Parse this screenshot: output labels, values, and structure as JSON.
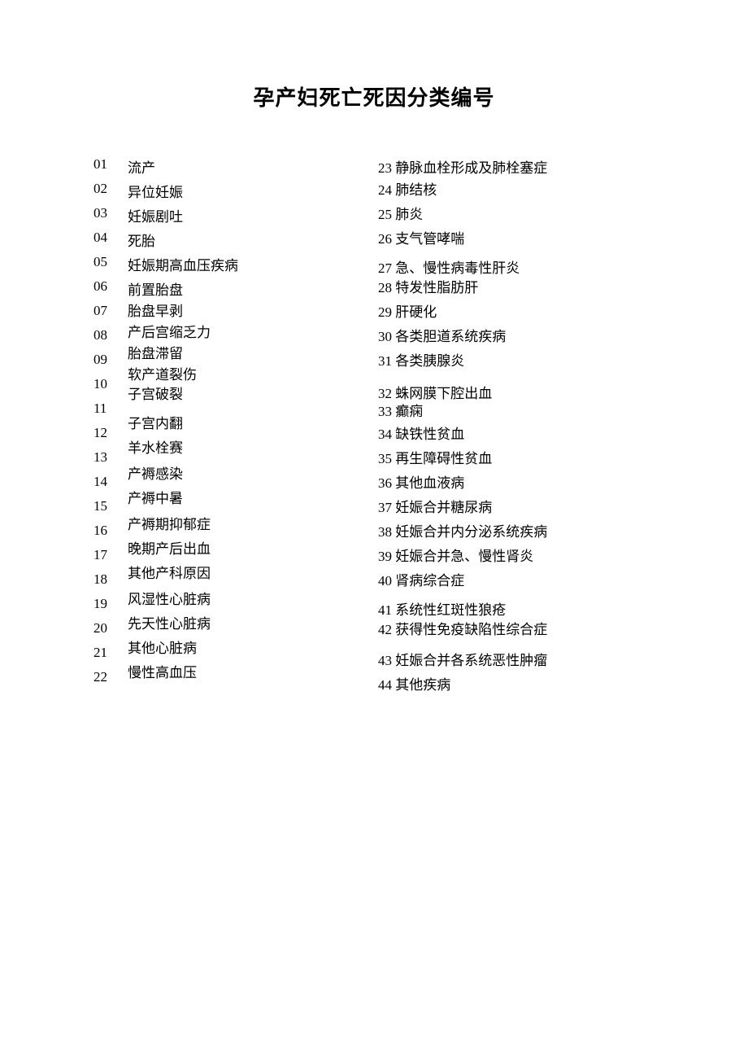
{
  "title": "孕产妇死亡死因分类编号",
  "left_numbers": [
    "01",
    "02",
    "03",
    "04",
    "05",
    "06",
    "07",
    "08",
    "09",
    "10",
    "11",
    "12",
    "13",
    "14",
    "15",
    "16",
    "17",
    "18",
    "19",
    "20",
    "21",
    "22"
  ],
  "left_labels": [
    "流产",
    "异位妊娠",
    "妊娠剧吐",
    "死胎",
    "妊娠期高血压疾病",
    "前置胎盘",
    "胎盘早剥",
    "产后宫缩乏力",
    "胎盘滞留",
    "软产道裂伤",
    "子宫破裂",
    "子宫内翻",
    "羊水栓赛",
    "产褥感染",
    "产褥中暑",
    "产褥期抑郁症",
    "晚期产后出血",
    "其他产科原因",
    "风湿性心脏病",
    "先天性心脏病",
    "其他心脏病",
    "慢性高血压"
  ],
  "right_items": [
    "23 静脉血栓形成及肺栓塞症",
    "24 肺结核",
    "25 肺炎",
    "26 支气管哮喘",
    "27 急、慢性病毒性肝炎",
    "28 特发性脂肪肝",
    "29 肝硬化",
    "30 各类胆道系统疾病",
    "31 各类胰腺炎",
    "32 蛛网膜下腔出血",
    "33 癫痫",
    "34 缺铁性贫血",
    "35 再生障碍性贫血",
    "36 其他血液病",
    "37 妊娠合并糖尿病",
    "38 妊娠合并内分泌系统疾病",
    "39 妊娠合并急、慢性肾炎",
    "40 肾病综合症",
    "41 系统性红斑性狼疮",
    "42 获得性免疫缺陷性综合症",
    "43 妊娠合并各系统恶性肿瘤",
    "44 其他疾病"
  ]
}
